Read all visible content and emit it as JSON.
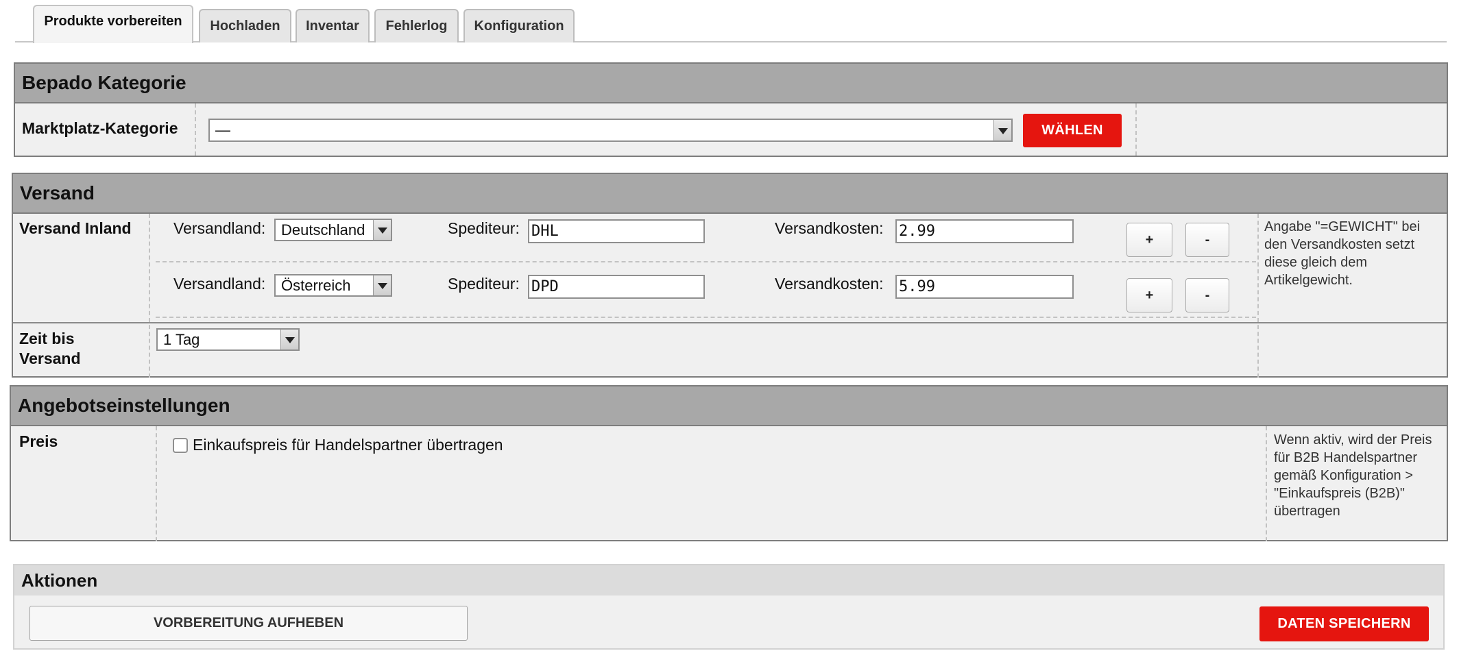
{
  "tabs": [
    {
      "label": "Produkte vorbereiten",
      "active": true
    },
    {
      "label": "Hochladen"
    },
    {
      "label": "Inventar"
    },
    {
      "label": "Fehlerlog"
    },
    {
      "label": "Konfiguration"
    }
  ],
  "category": {
    "title": "Bepado Kategorie",
    "row_label": "Marktplatz-Kategorie",
    "select_value": "—",
    "choose_button": "WÄHLEN"
  },
  "shipping": {
    "title": "Versand",
    "domestic_label": "Versand Inland",
    "country_label": "Versandland:",
    "carrier_label": "Spediteur:",
    "cost_label": "Versandkosten:",
    "rows": [
      {
        "country": "Deutschland",
        "carrier": "DHL",
        "cost": "2.99"
      },
      {
        "country": "Österreich",
        "carrier": "DPD",
        "cost": "5.99"
      }
    ],
    "plus": "+",
    "minus": "-",
    "note": "Angabe \"=GEWICHT\" bei den Versandkosten setzt diese gleich dem Artikelgewicht.",
    "time_label": "Zeit bis Versand",
    "time_value": "1 Tag"
  },
  "offer": {
    "title": "Angebotseinstellungen",
    "price_label": "Preis",
    "checkbox_label": "Einkaufspreis für Handelspartner übertragen",
    "checked": false,
    "note": "Wenn aktiv, wird der Preis für B2B Handelspartner gemäß Konfiguration > \"Einkaufspreis (B2B)\" übertragen"
  },
  "actions": {
    "title": "Aktionen",
    "reset_button": "VORBEREITUNG AUFHEBEN",
    "save_button": "DATEN SPEICHERN"
  },
  "colors": {
    "accent_red": "#e5150f",
    "header_gray": "#a8a8a8",
    "panel_bg": "#f0f0f0"
  }
}
